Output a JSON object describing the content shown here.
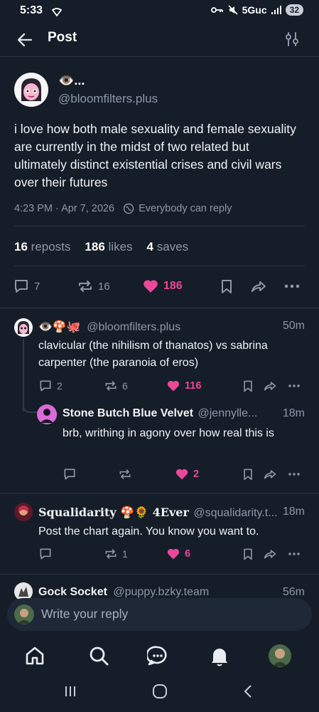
{
  "status_bar": {
    "time": "5:33",
    "network": "5Guc",
    "battery": "32"
  },
  "header": {
    "title": "Post"
  },
  "main_post": {
    "display_name": "👁️...",
    "handle": "@bloomfilters.plus",
    "text": "i love how both male sexuality and female sexuality are currently in the midst of two related but ultimately distinct existential crises and civil wars over their futures",
    "timestamp": "4:23 PM · Apr 7, 2026",
    "reply_setting": "Everybody can reply",
    "reposts_count": "16",
    "reposts_label": "reposts",
    "likes_count": "186",
    "likes_label": "likes",
    "saves_count": "4",
    "saves_label": "saves",
    "actions": {
      "replies": "7",
      "reposts": "16",
      "likes": "186"
    }
  },
  "replies": [
    {
      "display_name": "👁️🍄🐙",
      "handle": "@bloomfilters.plus",
      "time": "50m",
      "text": "clavicular (the nihilism of thanatos) vs sabrina carpenter (the paranoia of eros)",
      "replies": "2",
      "reposts": "6",
      "likes": "116"
    },
    {
      "display_name": "Stone Butch Blue Velvet",
      "handle": "@jennylle...",
      "time": "18m",
      "text": "brb, writhing in agony over how real this is",
      "replies": "",
      "reposts": "",
      "likes": "2"
    },
    {
      "display_name": "𝐒𝐪𝐮𝐚𝐥𝐢𝐝𝐚𝐫𝐢𝐭𝐲 🍄🌻 𝟒𝐄𝐯𝐞𝐫",
      "handle": "@squalidarity.t...",
      "time": "18m",
      "text": "Post the chart again. You know you want to.",
      "replies": "",
      "reposts": "1",
      "likes": "6"
    },
    {
      "display_name": "Gock Socket",
      "handle": "@puppy.bzky.team",
      "time": "56m"
    }
  ],
  "reply_input": {
    "placeholder": "Write your reply"
  },
  "colors": {
    "background": "#151d28",
    "accent_like": "#ec4899",
    "muted_text": "#8c98a8",
    "divider": "#2a3442"
  },
  "icons": [
    "back-arrow-icon",
    "filter-sliders-icon",
    "globe-icon",
    "comment-icon",
    "repost-icon",
    "heart-icon",
    "bookmark-icon",
    "share-icon",
    "more-icon",
    "home-icon",
    "search-icon",
    "chat-icon",
    "bell-icon"
  ]
}
